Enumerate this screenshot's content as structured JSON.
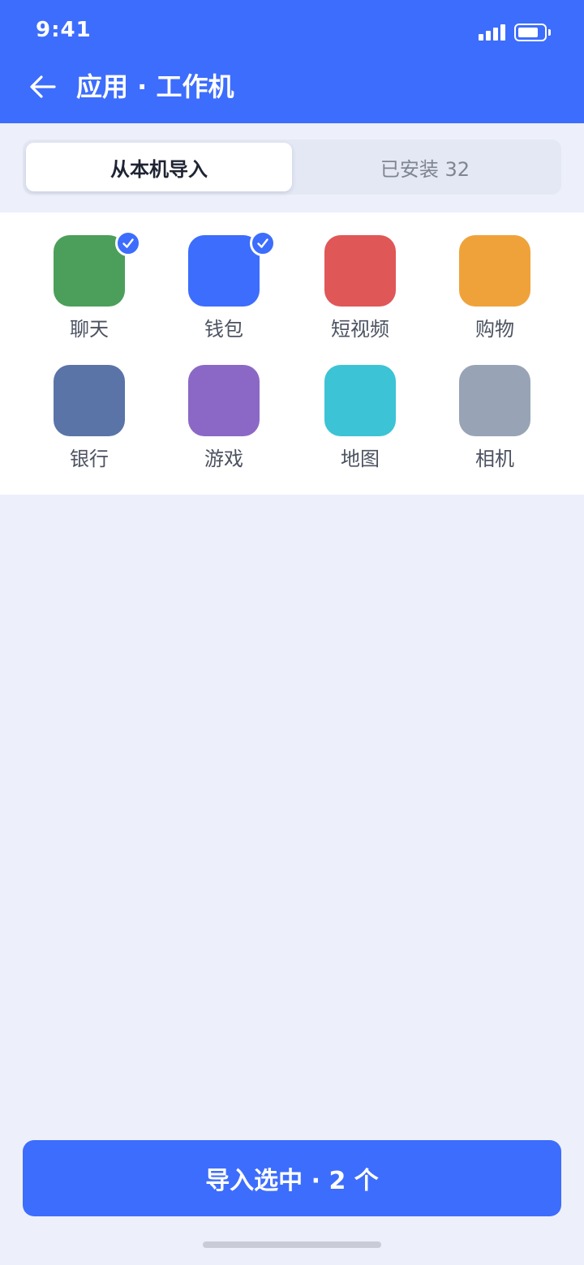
{
  "status_bar": {
    "time": "9:41"
  },
  "header": {
    "title": "应用 · 工作机",
    "back_icon": "arrow-left-icon"
  },
  "tabs": [
    {
      "label": "从本机导入",
      "active": true
    },
    {
      "label": "已安装 32",
      "active": false
    }
  ],
  "apps": [
    {
      "label": "聊天",
      "color": "#4b9f5b",
      "selected": true
    },
    {
      "label": "钱包",
      "color": "#3d6dfc",
      "selected": true
    },
    {
      "label": "短视频",
      "color": "#e05757",
      "selected": false
    },
    {
      "label": "购物",
      "color": "#f0a23a",
      "selected": false
    },
    {
      "label": "银行",
      "color": "#5a74a8",
      "selected": false
    },
    {
      "label": "游戏",
      "color": "#8b68c6",
      "selected": false
    },
    {
      "label": "地图",
      "color": "#3cc3d6",
      "selected": false
    },
    {
      "label": "相机",
      "color": "#98a4b5",
      "selected": false
    }
  ],
  "primary_action": {
    "label": "导入选中 · 2 个"
  },
  "colors": {
    "accent": "#3d6dfc",
    "background": "#edf0fa"
  }
}
